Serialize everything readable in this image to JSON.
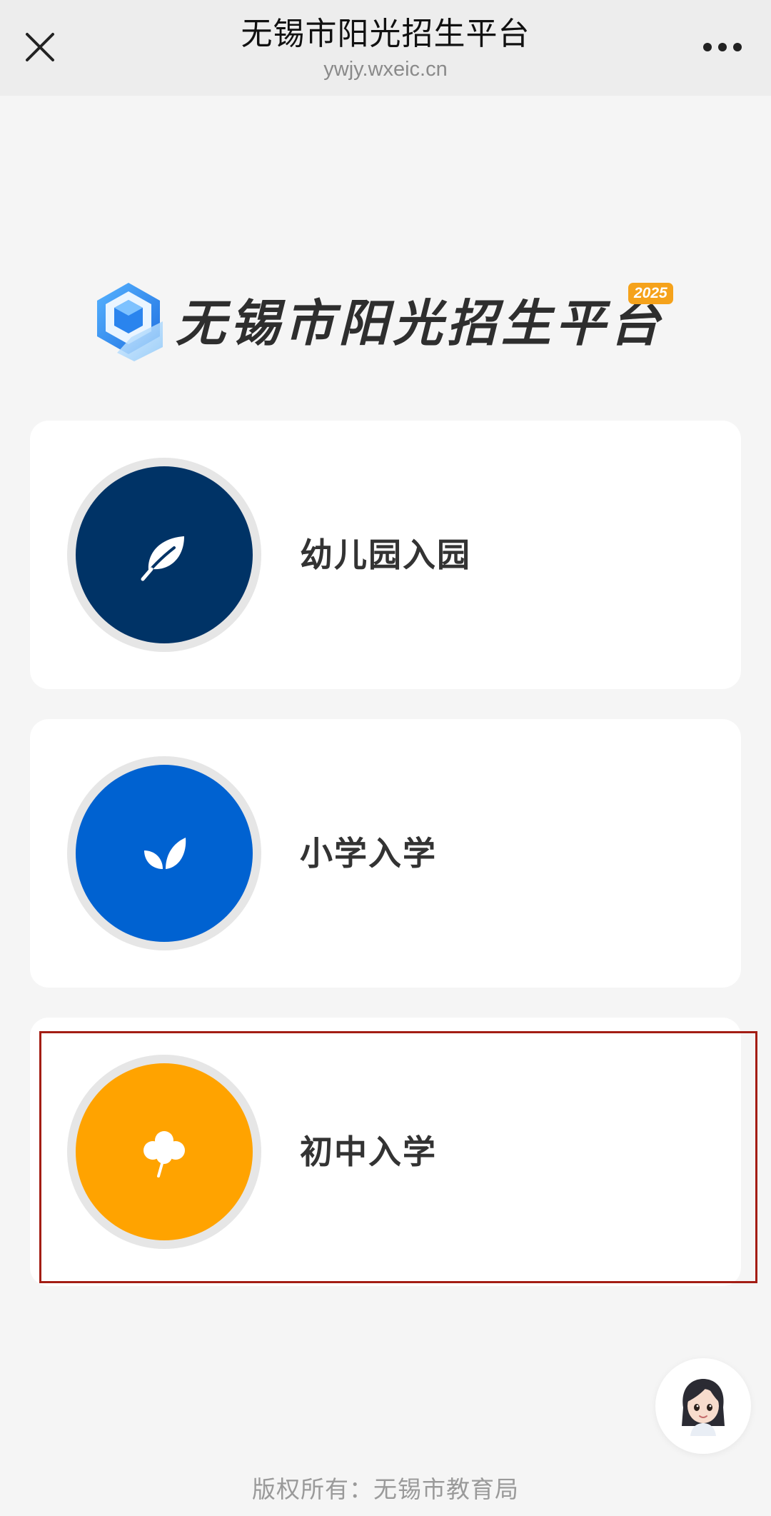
{
  "navbar": {
    "title": "无锡市阳光招生平台",
    "url": "ywjy.wxeic.cn",
    "close_icon": "close-icon",
    "more_icon": "more-dots-icon"
  },
  "brand": {
    "title": "无锡市阳光招生平台",
    "year_badge": "2025",
    "logo_icon": "cube-logo-icon",
    "colors": {
      "logo_blue": "#2f8ef0",
      "logo_light": "#9ed0fb",
      "badge": "#f5a21b"
    }
  },
  "options": [
    {
      "label": "幼儿园入园",
      "icon": "leaf-icon",
      "color": "#003366"
    },
    {
      "label": "小学入学",
      "icon": "sprout-icon",
      "color": "#0062d1"
    },
    {
      "label": "初中入学",
      "icon": "clover-icon",
      "color": "#ffa300"
    }
  ],
  "assistant": {
    "icon": "assistant-avatar-icon"
  },
  "footer": {
    "text": "版权所有：无锡市教育局"
  }
}
